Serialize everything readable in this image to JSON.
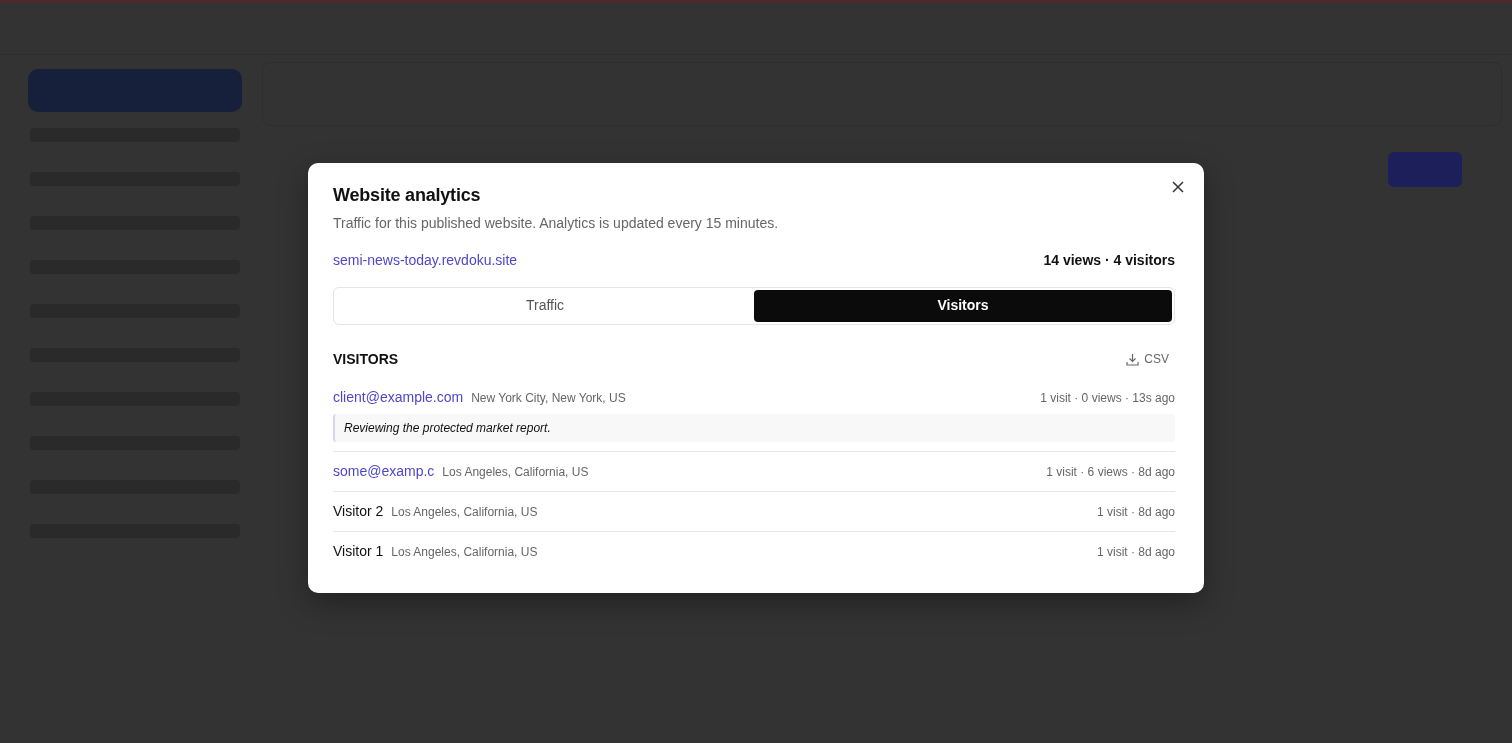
{
  "dialog": {
    "title": "Website analytics",
    "subtitle": "Traffic for this published website. Analytics is updated every 15 minutes.",
    "site_link": "semi-news-today.revdoku.site",
    "totals": "14 views · 4 visitors"
  },
  "tabs": [
    {
      "label": "Traffic",
      "selected": false
    },
    {
      "label": "Visitors",
      "selected": true
    }
  ],
  "visitors_section": {
    "heading": "VISITORS",
    "csv_button": "CSV"
  },
  "visitors": [
    {
      "kind": "email",
      "name": "client@example.com",
      "location": "New York City, New York, US",
      "stats": "1 visit · 0 views · 13s ago",
      "note": "Reviewing the protected market report."
    },
    {
      "kind": "email",
      "name": "some@examp.c",
      "location": "Los Angeles, California, US",
      "stats": "1 visit · 6 views · 8d ago"
    },
    {
      "kind": "anonymous",
      "name": "Visitor 2",
      "location": "Los Angeles, California, US",
      "stats": "1 visit · 8d ago"
    },
    {
      "kind": "anonymous",
      "name": "Visitor 1",
      "location": "Los Angeles, California, US",
      "stats": "1 visit · 8d ago"
    }
  ]
}
